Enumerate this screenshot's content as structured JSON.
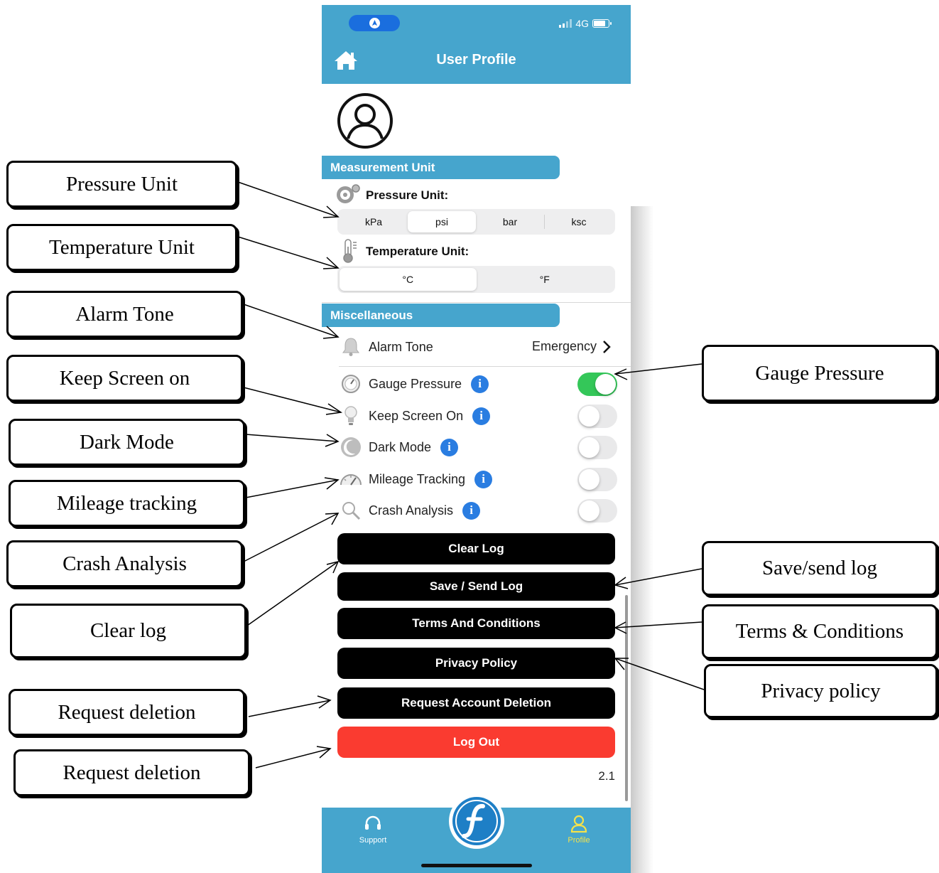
{
  "status_bar": {
    "network": "4G"
  },
  "header": {
    "title": "User Profile",
    "home_icon": "home-icon"
  },
  "measurement": {
    "section_title": "Measurement Unit",
    "pressure": {
      "label": "Pressure Unit:",
      "options": [
        "kPa",
        "psi",
        "bar",
        "ksc"
      ],
      "selected": "psi"
    },
    "temperature": {
      "label": "Temperature Unit:",
      "options": [
        "°C",
        "°F"
      ],
      "selected": "°C"
    }
  },
  "misc": {
    "section_title": "Miscellaneous",
    "alarm": {
      "label": "Alarm Tone",
      "value": "Emergency"
    },
    "toggles": [
      {
        "label": "Gauge Pressure",
        "on": true,
        "icon": "gauge-icon"
      },
      {
        "label": "Keep Screen On",
        "on": false,
        "icon": "bulb-icon"
      },
      {
        "label": "Dark Mode",
        "on": false,
        "icon": "moon-icon"
      },
      {
        "label": "Mileage Tracking",
        "on": false,
        "icon": "speedometer-icon"
      },
      {
        "label": "Crash Analysis",
        "on": false,
        "icon": "magnifier-icon"
      }
    ]
  },
  "buttons": {
    "clear_log": "Clear Log",
    "save_send_log": "Save / Send Log",
    "terms": "Terms And Conditions",
    "privacy": "Privacy Policy",
    "delete_account": "Request Account Deletion",
    "logout": "Log Out"
  },
  "version": "2.1",
  "tabbar": {
    "support": "Support",
    "profile": "Profile"
  },
  "callouts": {
    "pressure_unit": "Pressure Unit",
    "temperature_unit": "Temperature Unit",
    "alarm_tone": "Alarm Tone",
    "keep_screen_on": "Keep Screen on",
    "dark_mode": "Dark Mode",
    "mileage_tracking": "Mileage tracking",
    "crash_analysis": "Crash Analysis",
    "clear_log": "Clear log",
    "request_deletion_1": "Request deletion",
    "request_deletion_2": "Request deletion",
    "gauge_pressure": "Gauge Pressure",
    "save_send_log": "Save/send log",
    "terms_conditions": "Terms & Conditions",
    "privacy_policy": "Privacy policy"
  },
  "colors": {
    "brand_blue": "#46a5cd",
    "toggle_on": "#34c759",
    "logout_red": "#fa3b30",
    "info_blue": "#2a7de1",
    "active_tab": "#f5e24a"
  }
}
